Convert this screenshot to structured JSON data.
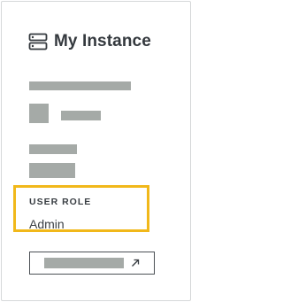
{
  "panel": {
    "title": "My Instance",
    "icons": {
      "header": "server-icon",
      "button": "external-link-arrow-icon"
    }
  },
  "role": {
    "label": "USER ROLE",
    "value": "Admin"
  },
  "colors": {
    "highlight": "#f1b81a",
    "placeholder": "#a5aaa7",
    "text": "#3a3f44"
  }
}
